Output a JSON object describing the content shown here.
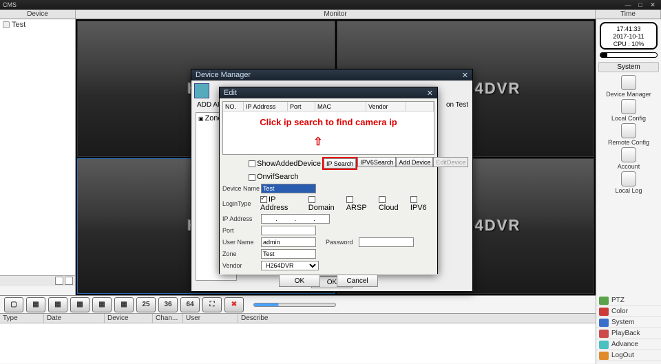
{
  "app": {
    "title": "CMS"
  },
  "win_controls": {
    "min": "—",
    "max": "□",
    "close": "✕"
  },
  "header": {
    "device": "Device",
    "monitor": "Monitor",
    "time": "Time"
  },
  "tree": {
    "root": "Test"
  },
  "video": {
    "brand": "H.264DVR",
    "left_brand": "H.26"
  },
  "time_card": {
    "time": "17:41:33",
    "date": "2017-10-11",
    "cpu": "CPU : 10%"
  },
  "system": {
    "title": "System",
    "items": [
      {
        "label": "Device Manager"
      },
      {
        "label": "Local Config"
      },
      {
        "label": "Remote Config"
      },
      {
        "label": "Account"
      },
      {
        "label": "Local Log"
      }
    ]
  },
  "grid_toolbar": {
    "n25": "25",
    "n36": "36",
    "n64": "64"
  },
  "log_table": {
    "cols": {
      "type": "Type",
      "date": "Date",
      "device": "Device",
      "chan": "Chan...",
      "user": "User",
      "describe": "Describe"
    }
  },
  "right_tabs": [
    {
      "label": "PTZ",
      "color": "#5aa34a"
    },
    {
      "label": "Color",
      "color": "#cc3a3a"
    },
    {
      "label": "System",
      "color": "#3a70cc"
    },
    {
      "label": "PlayBack",
      "color": "#cc4a4a"
    },
    {
      "label": "Advance",
      "color": "#4ac0c0"
    },
    {
      "label": "LogOut",
      "color": "#e08a2a"
    }
  ],
  "dm": {
    "title": "Device Manager",
    "add_area": "ADD  AR",
    "zone_label": "Zone",
    "ok": "OK",
    "conn_test": "on  Test"
  },
  "edit": {
    "title": "Edit",
    "cols": {
      "no": "NO.",
      "ip": "IP Address",
      "port": "Port",
      "mac": "MAC",
      "vendor": "Vendor"
    },
    "overlay_text": "Click ip search to find camera ip",
    "arrow": "⇧",
    "chk_show_added": "ShowAddedDevice",
    "chk_onvif": "OnvifSearch",
    "btn_ip_search": "IP Search",
    "btn_ipv6_search": "IPV6Search",
    "btn_add_device": "Add Device",
    "btn_edit_device": "EditDevice",
    "labels": {
      "device_name": "Device Name",
      "login_type": "LoginType",
      "ip_address": "IP Address",
      "port": "Port",
      "user_name": "User Name",
      "password": "Password",
      "zone": "Zone",
      "vendor": "Vendor"
    },
    "login_types": {
      "ip": "IP Address",
      "domain": "Domain",
      "arsp": "ARSP",
      "cloud": "Cloud",
      "ipv6": "IPV6"
    },
    "values": {
      "device_name": "Test",
      "ip_dots": ".          .          .",
      "port": "",
      "user": "admin",
      "password": "",
      "zone": "Test",
      "vendor": "H264DVR"
    },
    "ok": "OK",
    "cancel": "Cancel"
  }
}
